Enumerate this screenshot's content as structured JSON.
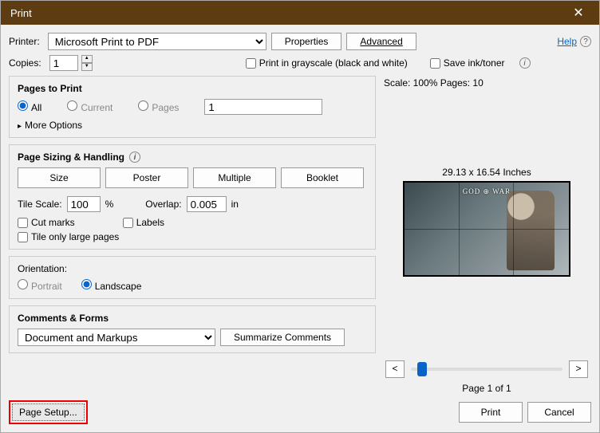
{
  "titlebar": {
    "title": "Print"
  },
  "top": {
    "printer_label": "Printer:",
    "printer_value": "Microsoft Print to PDF",
    "properties_btn": "Properties",
    "advanced_btn": "Advanced",
    "help_text": "Help"
  },
  "copies": {
    "label": "Copies:",
    "value": "1",
    "grayscale_label": "Print in grayscale (black and white)",
    "saveink_label": "Save ink/toner"
  },
  "pages": {
    "header": "Pages to Print",
    "all": "All",
    "current": "Current",
    "pages": "Pages",
    "pages_value": "1",
    "more": "More Options"
  },
  "sizing": {
    "header": "Page Sizing & Handling",
    "size_btn": "Size",
    "poster_btn": "Poster",
    "multiple_btn": "Multiple",
    "booklet_btn": "Booklet",
    "tilescale_label": "Tile Scale:",
    "tilescale_value": "100",
    "percent": "%",
    "overlap_label": "Overlap:",
    "overlap_value": "0.005",
    "inches": "in",
    "cutmarks": "Cut marks",
    "labels": "Labels",
    "tileonly": "Tile only large pages"
  },
  "orientation": {
    "header": "Orientation:",
    "portrait": "Portrait",
    "landscape": "Landscape"
  },
  "comments": {
    "header": "Comments & Forms",
    "value": "Document and Markups",
    "summarize_btn": "Summarize Comments"
  },
  "preview": {
    "scale_info": "Scale: 100% Pages: 10",
    "dims": "29.13 x 16.54 Inches",
    "logo": "GOD ⊕ WAR",
    "prev": "<",
    "next": ">",
    "pageof": "Page 1 of 1"
  },
  "footer": {
    "pagesetup": "Page Setup...",
    "print": "Print",
    "cancel": "Cancel"
  }
}
